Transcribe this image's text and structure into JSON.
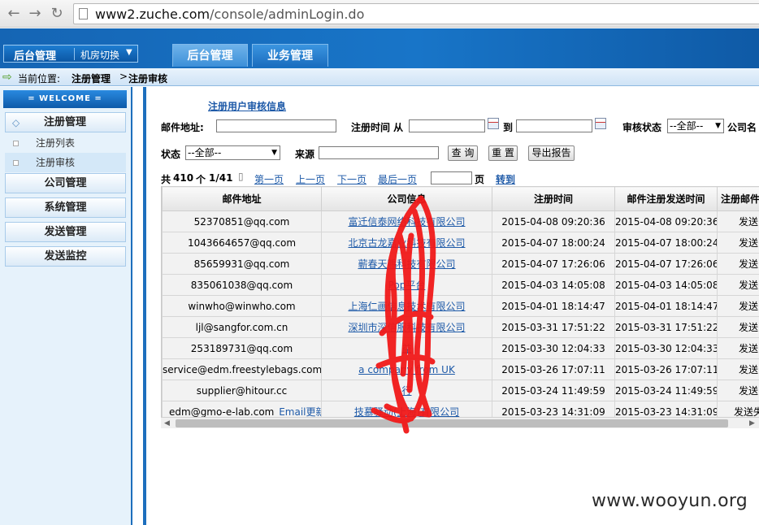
{
  "browser": {
    "url_host": "www2.zuche.com",
    "url_path": "/console/adminLogin.do"
  },
  "header": {
    "admin_label": "后台管理",
    "room_switch_label": "机房切换",
    "tabs": [
      {
        "label": "后台管理",
        "active": true
      },
      {
        "label": "业务管理",
        "active": false
      }
    ]
  },
  "breadcrumb": {
    "prefix": "当前位置:",
    "items": [
      "注册管理",
      "注册审核"
    ],
    "separator": ">"
  },
  "sidebar": {
    "welcome": "= WELCOME =",
    "open_section": "注册管理",
    "sub_items": [
      {
        "label": "注册列表",
        "active": false
      },
      {
        "label": "注册审核",
        "active": true
      }
    ],
    "sections": [
      "公司管理",
      "系统管理",
      "发送管理",
      "发送监控"
    ]
  },
  "main": {
    "title": "注册用户审核信息",
    "filters": {
      "email_label": "邮件地址:",
      "reg_time_label": "注册时间 从",
      "to_label": "到",
      "audit_status_label": "审核状态",
      "audit_status_value": "--全部--",
      "company_label": "公司名",
      "status_label": "状态",
      "status_value": "--全部--",
      "source_label": "来源"
    },
    "buttons": {
      "query": "查 询",
      "reset": "重 置",
      "export": "导出报告"
    },
    "pager": {
      "total_prefix": "共",
      "total": "410",
      "total_suffix": "个",
      "page_info": "1/41",
      "first": "第一页",
      "prev": "上一页",
      "next": "下一页",
      "last": "最后一页",
      "page_label": "页",
      "goto": "转到"
    },
    "table": {
      "columns": [
        "邮件地址",
        "公司信息",
        "注册时间",
        "邮件注册发送时间",
        "注册邮件"
      ],
      "edit_label": "Email更新",
      "rows": [
        {
          "email": "52370851@qq.com",
          "company": "富迁信泰网络科技有限公司",
          "reg_time": "2015-04-08 09:20:36",
          "send_time": "2015-04-08 09:20:36",
          "status": "发送"
        },
        {
          "email": "1043664657@qq.com",
          "company": "北京古龙嘉业科技有限公司",
          "reg_time": "2015-04-07 18:00:24",
          "send_time": "2015-04-07 18:00:24",
          "status": "发送"
        },
        {
          "email": "85659931@qq.com",
          "company": "蕲春天赐科技有限公司",
          "reg_time": "2015-04-07 17:26:06",
          "send_time": "2015-04-07 17:26:06",
          "status": "发送"
        },
        {
          "email": "835061038@qq.com",
          "company": "Pop平台",
          "reg_time": "2015-04-03 14:05:08",
          "send_time": "2015-04-03 14:05:08",
          "status": "发送"
        },
        {
          "email": "winwho@winwho.com",
          "company": "上海仁画信息技术有限公司",
          "reg_time": "2015-04-01 18:14:47",
          "send_time": "2015-04-01 18:14:47",
          "status": "发送"
        },
        {
          "email": "ljl@sangfor.com.cn",
          "company": "深圳市深信服科技有限公司",
          "reg_time": "2015-03-31 17:51:22",
          "send_time": "2015-03-31 17:51:22",
          "status": "发送"
        },
        {
          "email": "253189731@qq.com",
          "company": "益",
          "reg_time": "2015-03-30 12:04:33",
          "send_time": "2015-03-30 12:04:33",
          "status": "发送"
        },
        {
          "email": "service@edm.freestylebags.com",
          "company": "a company from UK",
          "reg_time": "2015-03-26 17:07:11",
          "send_time": "2015-03-26 17:07:11",
          "status": "发送"
        },
        {
          "email": "supplier@hitour.cc",
          "company": "行",
          "reg_time": "2015-03-24 11:49:59",
          "send_time": "2015-03-24 11:49:59",
          "status": "发送"
        },
        {
          "email": "edm@gmo-e-lab.com",
          "company": "技慕驿动(上海)有限公司",
          "reg_time": "2015-03-23 14:31:09",
          "send_time": "2015-03-23 14:31:09",
          "status": "发送失"
        }
      ]
    }
  },
  "watermark": "www.wooyun.org",
  "colors": {
    "header_blue": "#1875c8",
    "link_blue": "#1e5aa8",
    "scribble_red": "#f01818"
  }
}
